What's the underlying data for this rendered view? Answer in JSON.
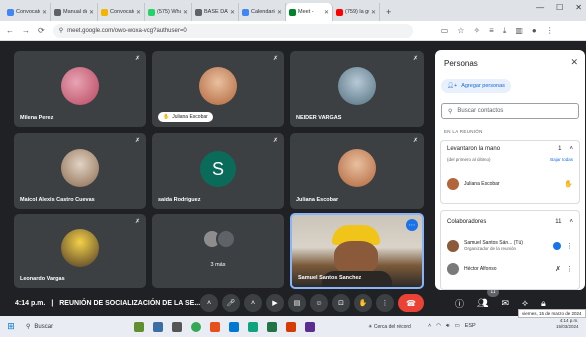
{
  "browser": {
    "tabs": [
      {
        "title": "Convocator",
        "color": "#4285f4"
      },
      {
        "title": "Manual de",
        "color": "#5f6368"
      },
      {
        "title": "Convocato",
        "color": "#f4b400"
      },
      {
        "title": "(575) Wha",
        "color": "#25d366"
      },
      {
        "title": "BASE DATOS",
        "color": "#5f6368"
      },
      {
        "title": "Calendario",
        "color": "#4285f4"
      },
      {
        "title": "Meet - ",
        "color": "#00832d"
      },
      {
        "title": "(759) la gui",
        "color": "#ff0000"
      }
    ],
    "new_tab": "+",
    "url": "meet.google.com/owo-woxa-vcg?authuser=0"
  },
  "tiles": [
    {
      "name": "Milena Perez"
    },
    {
      "name": "Juliana Escobar"
    },
    {
      "name": "NEIDER VARGAS"
    },
    {
      "name": "Maicol Alexis Castro Cuevas"
    },
    {
      "name": "saida Rodriguez",
      "letter": "S"
    },
    {
      "name": "Juliana Escobar"
    },
    {
      "name": "Leonardo Vargas"
    },
    {
      "name": "3 más"
    },
    {
      "name": "Samuel Santos Sanchez"
    }
  ],
  "controls": {
    "time": "4:14 p.m.",
    "separator": "|",
    "meeting_title": "REUNIÓN DE SOCIALIZACIÓN DE LA SE...",
    "participants_badge": "11"
  },
  "people_panel": {
    "title": "Personas",
    "add_people": "Agregar personas",
    "search_placeholder": "Buscar contactos",
    "section_label": "EN LA REUNIÓN",
    "raised": {
      "label": "Levantaron la mano",
      "count": "1",
      "order_note": "(del primero al último)",
      "lower_all": "Bajar todas",
      "person": "Juliana Escobar"
    },
    "collaborators": {
      "label": "Colaboradores",
      "count": "11",
      "people": [
        {
          "name": "Samuel Santos Sán... (Tú)",
          "role": "Organizador de la reunión"
        },
        {
          "name": "Héctor Alfonso",
          "role": ""
        }
      ]
    }
  },
  "taskbar": {
    "search": "Buscar",
    "weather": "Cerca del récord",
    "lang": "ESP",
    "time": "4:14 p.m.",
    "date": "15/03/2024",
    "tooltip": "viernes, 15 de marzo de 2024"
  }
}
